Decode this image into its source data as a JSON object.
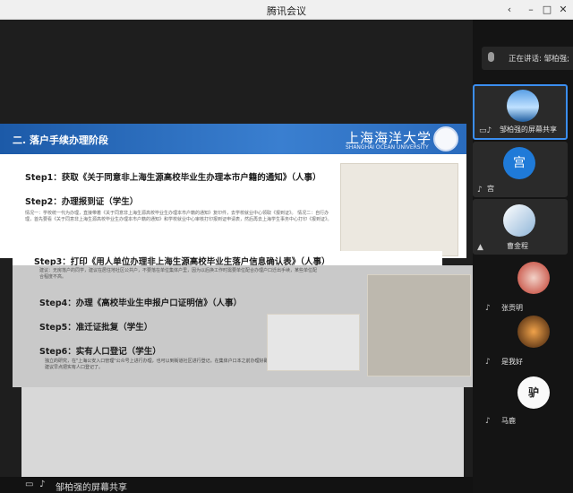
{
  "window": {
    "title": "腾讯会议",
    "controls": [
      "‹",
      "–",
      "□",
      "✕"
    ]
  },
  "speaking": {
    "text": "正在讲话: 邹柏强;"
  },
  "participants": [
    {
      "name": "邹柏强的屏幕共享",
      "active": true
    },
    {
      "name": "宫",
      "avatar_text": "宫"
    },
    {
      "name": "曹金程"
    },
    {
      "name": "张贡明"
    },
    {
      "name": "是我好"
    },
    {
      "name": "马鹿",
      "avatar_text": "驴"
    }
  ],
  "bottom": {
    "share_label": "邹柏强的屏幕共享"
  },
  "slide": {
    "header_title": "二. 落户手续办理阶段",
    "logo_cn": "上海海洋大学",
    "logo_en": "SHANGHAI OCEAN UNIVERSITY",
    "steps": [
      "Step1：获取《关于同意非上海生源高校毕业生办理本市户籍的通知》（人事）",
      "Step2：办理报到证（学生）",
      "Step3：打印《用人单位办理非上海生源高校毕业生落户信息确认表》（人事）",
      "Step4：办理《高校毕业生申报户口证明信》（人事）",
      "Step5：准迁证批复（学生）",
      "Step6：实有人口登记（学生）"
    ],
    "note2": "情况一：学校统一代为办理，直接带着《关于同意非上海生源高校毕业生办理本市户籍的通知》复印件，去学校就业中心领取《报到证》。 情况二：自行办理，首先要看《关于同意非上海生源高校毕业生办理本市户籍的通知》和学校就业中心审核打印报到证申请表，然后再去上海学生事务中心打印《报到证》。",
    "note3": "建议：无房落户的同学，建议在居住地社区公共户，不要落在单位集体户里，因为以后换工作时需要单位配合办理户口迁出手续，某些单位配合程度不高。",
    "note6": "独立的研究，在\"上海公安入口管理\"公众号上进行办理，也可以到街道社区进行登记。在集体户口本之前办理好即可，建议早点把实有人口登记了。"
  }
}
